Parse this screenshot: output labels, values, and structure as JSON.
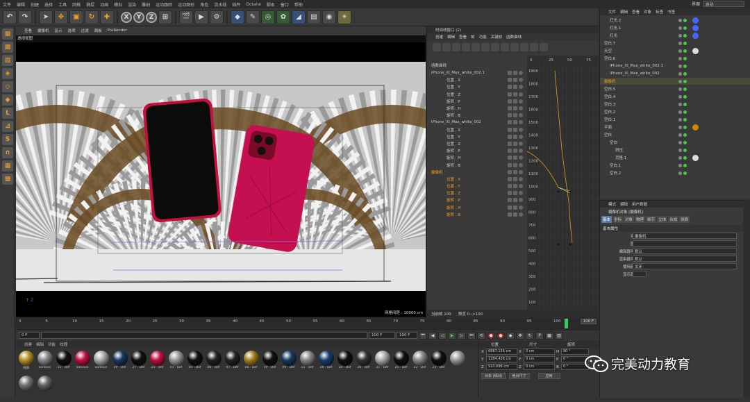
{
  "menu": [
    "文件",
    "编辑",
    "创建",
    "选择",
    "工具",
    "网格",
    "捕捉",
    "动画",
    "模拟",
    "渲染",
    "雕刻",
    "运动跟踪",
    "运动图形",
    "角色",
    "流水线",
    "插件",
    "Octane",
    "脚本",
    "窗口",
    "帮助"
  ],
  "layout": {
    "label": "界面",
    "value": "启动"
  },
  "viewport": {
    "menu": [
      "查看",
      "摄像机",
      "显示",
      "选项",
      "过滤",
      "面板",
      "ProRender"
    ],
    "title": "透视视图",
    "grid": "网格间距 : 10000 cm",
    "axis": "Z"
  },
  "timeline": {
    "ticks": [
      "0",
      "5",
      "10",
      "15",
      "20",
      "25",
      "30",
      "35",
      "40",
      "45",
      "50",
      "55",
      "60",
      "65",
      "70",
      "75",
      "80",
      "85",
      "90",
      "95",
      "100"
    ],
    "end": "100 F"
  },
  "transport": {
    "start": "0 F",
    "field2": "0 F",
    "end": "100 F",
    "end2": "100 F"
  },
  "materials": {
    "tabs": [
      "创建",
      "编辑",
      "功能",
      "纹理"
    ],
    "items": [
      {
        "n": "材质",
        "c": "#b8902a"
      },
      {
        "n": "Samsun",
        "c": "#888"
      },
      {
        "n": "11 - Def",
        "c": "#111"
      },
      {
        "n": "Samsun",
        "c": "#c01040"
      },
      {
        "n": "Samsun",
        "c": "#aaa"
      },
      {
        "n": "29 - Def",
        "c": "#1a3a60"
      },
      {
        "n": "27 - Def",
        "c": "#111"
      },
      {
        "n": "24 - Def",
        "c": "#c01040"
      },
      {
        "n": "03 - Def",
        "c": "#999"
      },
      {
        "n": "05 - Def",
        "c": "#111"
      },
      {
        "n": "06 - Def",
        "c": "#222"
      },
      {
        "n": "07 - Def",
        "c": "#222"
      },
      {
        "n": "08 - Def",
        "c": "#a08020"
      },
      {
        "n": "19 - Def",
        "c": "#111"
      },
      {
        "n": "09 - Def",
        "c": "#1a3a60"
      },
      {
        "n": "11 - Def",
        "c": "#888"
      },
      {
        "n": "28 - Def",
        "c": "#1a4070"
      },
      {
        "n": "24 - Def",
        "c": "#111"
      },
      {
        "n": "26 - Def",
        "c": "#333"
      },
      {
        "n": "21 - Def",
        "c": "#aaa"
      },
      {
        "n": "25 - Def",
        "c": "#111"
      },
      {
        "n": "23 - Def",
        "c": "#888"
      },
      {
        "n": "23 - Def",
        "c": "#111"
      },
      {
        "n": "",
        "c": "#999"
      },
      {
        "n": "",
        "c": "#777"
      },
      {
        "n": "",
        "c": "#666"
      }
    ]
  },
  "coords": {
    "headers": [
      "位置",
      "尺寸",
      "旋转"
    ],
    "rows": [
      {
        "a": "X",
        "p": "6887.156 cm",
        "s": "0 cm",
        "r": "H",
        "rv": "90 °"
      },
      {
        "a": "Y",
        "p": "1284.426 cm",
        "s": "0 cm",
        "r": "P",
        "rv": "0 °"
      },
      {
        "a": "Z",
        "p": "910.696 cm",
        "s": "0 cm",
        "r": "B",
        "rv": "0 °"
      }
    ],
    "btn1": "对象 (相对)",
    "btn2": "绝对尺寸",
    "apply": "应用"
  },
  "graph": {
    "title": "时间线窗口 (2)",
    "menu": [
      "创建",
      "编辑",
      "查看",
      "帧",
      "功能",
      "关键帧",
      "函数曲线"
    ],
    "header": "函数曲线",
    "tracks": [
      {
        "n": "iPhone_Xl_Max_white_002.1",
        "lvl": 0
      },
      {
        "n": "位置 . X",
        "lvl": 1
      },
      {
        "n": "位置 . Y",
        "lvl": 1
      },
      {
        "n": "位置 . Z",
        "lvl": 1
      },
      {
        "n": "旋转 . P",
        "lvl": 1
      },
      {
        "n": "旋转 . H",
        "lvl": 1
      },
      {
        "n": "旋转 . B",
        "lvl": 1
      },
      {
        "n": "iPhone_Xl_Max_white_002",
        "lvl": 0
      },
      {
        "n": "位置 . X",
        "lvl": 1
      },
      {
        "n": "位置 . Y",
        "lvl": 1
      },
      {
        "n": "位置 . Z",
        "lvl": 1
      },
      {
        "n": "旋转 . P",
        "lvl": 1
      },
      {
        "n": "旋转 . H",
        "lvl": 1
      },
      {
        "n": "旋转 . B",
        "lvl": 1
      },
      {
        "n": "摄像机",
        "lvl": 0,
        "cam": true
      },
      {
        "n": "位置 . X",
        "lvl": 1,
        "cam": true
      },
      {
        "n": "位置 . Y",
        "lvl": 1,
        "cam": true
      },
      {
        "n": "位置 . Z",
        "lvl": 1,
        "cam": true
      },
      {
        "n": "旋转 . P",
        "lvl": 1,
        "cam": true
      },
      {
        "n": "旋转 . H",
        "lvl": 1,
        "cam": true
      },
      {
        "n": "旋转 . B",
        "lvl": 1,
        "cam": true
      }
    ],
    "xticks": [
      "0",
      "25",
      "50",
      "75"
    ],
    "yticks": [
      "1900",
      "1800",
      "1700",
      "1600",
      "1500",
      "1400",
      "1300",
      "1200",
      "1100",
      "1000",
      "900",
      "800",
      "700",
      "600",
      "500",
      "400",
      "300",
      "200",
      "100"
    ],
    "status": [
      "当前帧 100",
      "预览 0-->100"
    ]
  },
  "objects": {
    "menu": [
      "文件",
      "编辑",
      "查看",
      "对象",
      "标签",
      "书签"
    ],
    "rows": [
      {
        "n": "灯光.2",
        "lvl": 1
      },
      {
        "n": "灯光.1",
        "lvl": 1
      },
      {
        "n": "灯光",
        "lvl": 1
      },
      {
        "n": "空白.7",
        "lvl": 0
      },
      {
        "n": "天空",
        "lvl": 0
      },
      {
        "n": "空白.6",
        "lvl": 0
      },
      {
        "n": "iPhone_Xl_Max_white_002.1",
        "lvl": 1
      },
      {
        "n": "iPhone_Xl_Max_white_002",
        "lvl": 1
      },
      {
        "n": "摄像机",
        "lvl": 0,
        "cam": true
      },
      {
        "n": "空白.5",
        "lvl": 0
      },
      {
        "n": "空白.4",
        "lvl": 0
      },
      {
        "n": "空白.3",
        "lvl": 0
      },
      {
        "n": "空白.2",
        "lvl": 0
      },
      {
        "n": "空白.1",
        "lvl": 0
      },
      {
        "n": "平面",
        "lvl": 0
      },
      {
        "n": "空白",
        "lvl": 0
      },
      {
        "n": "空白",
        "lvl": 1
      },
      {
        "n": "挤压",
        "lvl": 2
      },
      {
        "n": "克隆.1",
        "lvl": 2
      },
      {
        "n": "空白.1",
        "lvl": 1
      },
      {
        "n": "空白.2",
        "lvl": 1
      }
    ]
  },
  "attributes": {
    "menu": [
      "模式",
      "编辑",
      "用户数据"
    ],
    "title": "摄像机对象 [摄像机]",
    "tabs": [
      "基本",
      "坐标",
      "对象",
      "物理",
      "细节",
      "立体",
      "合成",
      "球面"
    ],
    "section": "基本属性",
    "rows": [
      {
        "l": "名称",
        "v": "摄像机"
      },
      {
        "l": "图层",
        "v": ""
      },
      {
        "l": "编辑器可见",
        "v": "默认"
      },
      {
        "l": "渲染器可见",
        "v": "默认"
      },
      {
        "l": "使用颜色",
        "v": "关闭"
      },
      {
        "l": "显示颜色",
        "v": ""
      }
    ]
  },
  "watermark": "完美动力教育"
}
